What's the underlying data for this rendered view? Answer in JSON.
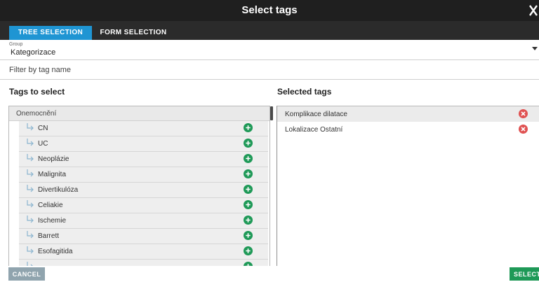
{
  "dialog": {
    "title": "Select tags",
    "close_icon": "close-icon"
  },
  "tabs": [
    {
      "label": "TREE SELECTION",
      "active": true
    },
    {
      "label": "FORM SELECTION",
      "active": false
    }
  ],
  "group": {
    "caption": "Group",
    "value": "Kategorizace"
  },
  "filter": {
    "placeholder": "Filter by tag name",
    "value": ""
  },
  "tags_to_select": {
    "header": "Tags to select",
    "root": "Onemocnění",
    "items": [
      {
        "label": "CN"
      },
      {
        "label": "UC"
      },
      {
        "label": "Neoplázie"
      },
      {
        "label": "Malignita"
      },
      {
        "label": "Divertikulóza"
      },
      {
        "label": "Celiakie"
      },
      {
        "label": "Ischemie"
      },
      {
        "label": "Barrett"
      },
      {
        "label": "Esofagitida"
      },
      {
        "label": ""
      }
    ]
  },
  "selected_tags": {
    "header": "Selected tags",
    "items": [
      {
        "label": "Komplikace dilatace"
      },
      {
        "label": "Lokalizace Ostatní"
      }
    ]
  },
  "footer": {
    "cancel_label": "CANCEL",
    "select_label": "SELECT"
  },
  "colors": {
    "title_bar": "#1f1f1f",
    "tab_active": "#1f95d3",
    "add_green": "#1e9957",
    "remove_red": "#e05252",
    "cancel_bg": "#90a4ae",
    "select_bg": "#1e9957"
  },
  "icons": {
    "child_arrow": "child-arrow-icon",
    "add": "add-icon",
    "remove": "remove-icon",
    "dropdown": "chevron-down-icon"
  }
}
